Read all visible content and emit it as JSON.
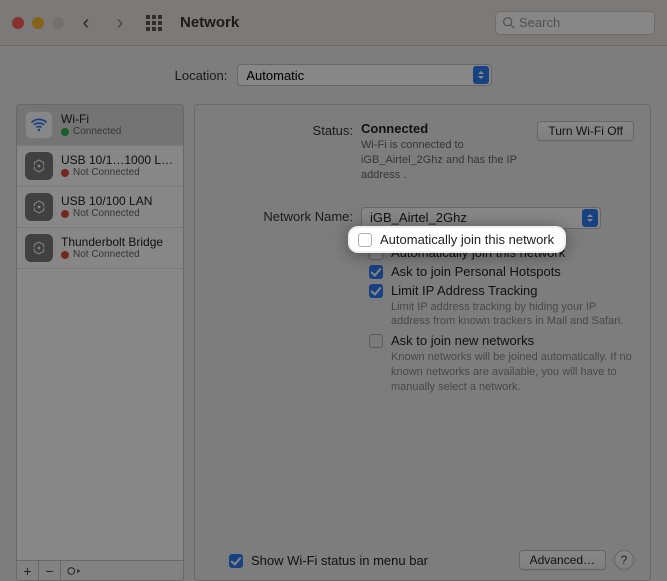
{
  "toolbar": {
    "title": "Network",
    "search_placeholder": "Search"
  },
  "location": {
    "label": "Location:",
    "value": "Automatic"
  },
  "sidebar": {
    "items": [
      {
        "name": "Wi-Fi",
        "status": "Connected",
        "state": "green",
        "kind": "wifi"
      },
      {
        "name": "USB 10/1…1000 LAN",
        "status": "Not Connected",
        "state": "red",
        "kind": "eth"
      },
      {
        "name": "USB 10/100 LAN",
        "status": "Not Connected",
        "state": "red",
        "kind": "eth"
      },
      {
        "name": "Thunderbolt Bridge",
        "status": "Not Connected",
        "state": "red",
        "kind": "eth"
      }
    ]
  },
  "detail": {
    "status_label": "Status:",
    "status_value": "Connected",
    "turn_off_label": "Turn Wi-Fi Off",
    "status_desc": "Wi-Fi is connected to iGB_Airtel_2Ghz and has the IP address .",
    "network_name_label": "Network Name:",
    "network_name_value": "iGB_Airtel_2Ghz",
    "auto_join_label": "Automatically join this network",
    "ask_hotspot_label": "Ask to join Personal Hotspots",
    "limit_ip_label": "Limit IP Address Tracking",
    "limit_ip_desc": "Limit IP address tracking by hiding your IP address from known trackers in Mail and Safari.",
    "ask_new_label": "Ask to join new networks",
    "ask_new_desc": "Known networks will be joined automatically. If no known networks are available, you will have to manually select a network.",
    "show_menu_label": "Show Wi-Fi status in menu bar",
    "advanced_label": "Advanced…"
  }
}
